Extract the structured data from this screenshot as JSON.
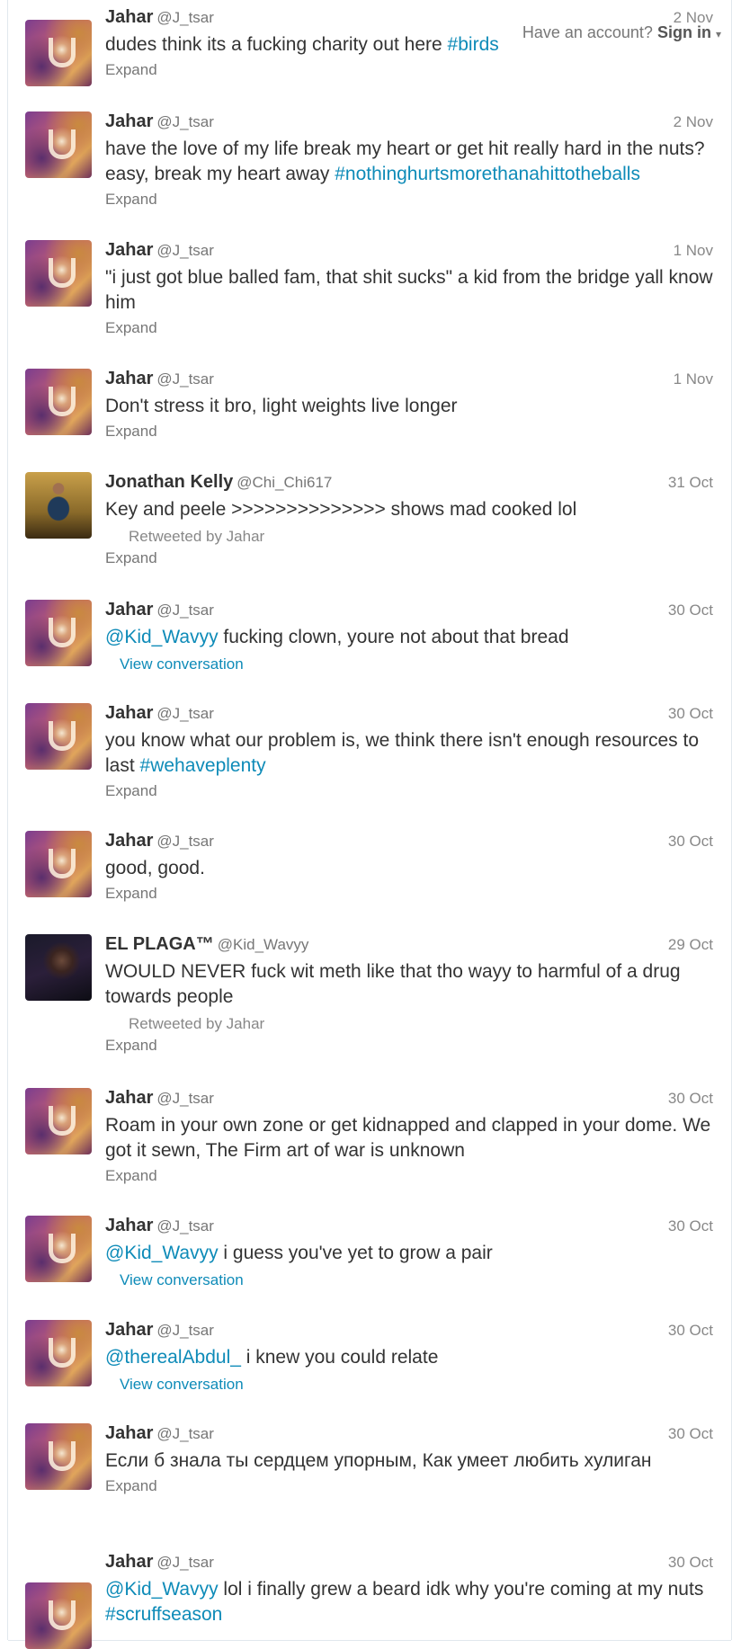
{
  "topbar": {
    "prompt": "Have an account?",
    "signin": "Sign in",
    "caret": "▾"
  },
  "tweets": [
    {
      "name": "Jahar",
      "handle": "@J_tsar",
      "time": "2 Nov",
      "avatar": "jahar",
      "parts": [
        {
          "t": "dudes think its a fucking charity out here "
        },
        {
          "t": "#birds",
          "link": true
        }
      ],
      "footer": "expand",
      "footer_text": "Expand"
    },
    {
      "name": "Jahar",
      "handle": "@J_tsar",
      "time": "2 Nov",
      "avatar": "jahar",
      "parts": [
        {
          "t": "have the love of my life break my heart or get hit really hard in the nuts? easy, break my heart away "
        },
        {
          "t": "#nothinghurtsmorethanahittotheballs",
          "link": true
        }
      ],
      "footer": "expand",
      "footer_text": "Expand"
    },
    {
      "name": "Jahar",
      "handle": "@J_tsar",
      "time": "1 Nov",
      "avatar": "jahar",
      "parts": [
        {
          "t": "\"i just got blue balled fam, that shit sucks\" a kid from the bridge yall know him"
        }
      ],
      "footer": "expand",
      "footer_text": "Expand"
    },
    {
      "name": "Jahar",
      "handle": "@J_tsar",
      "time": "1 Nov",
      "avatar": "jahar",
      "parts": [
        {
          "t": "Don't stress it bro, light weights live longer"
        }
      ],
      "footer": "expand",
      "footer_text": "Expand"
    },
    {
      "name": "Jonathan Kelly",
      "handle": "@Chi_Chi617",
      "time": "31 Oct",
      "avatar": "jonathan",
      "parts": [
        {
          "t": "Key and peele >>>>>>>>>>>>>> shows mad cooked lol"
        }
      ],
      "retweet": "Retweeted by Jahar",
      "footer": "expand",
      "footer_text": "Expand"
    },
    {
      "name": "Jahar",
      "handle": "@J_tsar",
      "time": "30 Oct",
      "avatar": "jahar",
      "parts": [
        {
          "t": "@Kid_Wavyy",
          "link": true
        },
        {
          "t": " fucking clown, youre not about that bread"
        }
      ],
      "footer": "conv",
      "footer_text": "View conversation"
    },
    {
      "name": "Jahar",
      "handle": "@J_tsar",
      "time": "30 Oct",
      "avatar": "jahar",
      "parts": [
        {
          "t": "you know what our problem is, we think there isn't enough resources to last "
        },
        {
          "t": "#wehaveplenty",
          "link": true
        }
      ],
      "footer": "expand",
      "footer_text": "Expand"
    },
    {
      "name": "Jahar",
      "handle": "@J_tsar",
      "time": "30 Oct",
      "avatar": "jahar",
      "parts": [
        {
          "t": "good, good."
        }
      ],
      "footer": "expand",
      "footer_text": "Expand"
    },
    {
      "name": "EL PLAGA™",
      "handle": "@Kid_Wavyy",
      "time": "29 Oct",
      "avatar": "plaga",
      "parts": [
        {
          "t": "WOULD NEVER fuck wit meth like that tho wayy to harmful of a drug towards people"
        }
      ],
      "retweet": "Retweeted by Jahar",
      "footer": "expand",
      "footer_text": "Expand"
    },
    {
      "name": "Jahar",
      "handle": "@J_tsar",
      "time": "30 Oct",
      "avatar": "jahar",
      "parts": [
        {
          "t": "Roam in your own zone or get kidnapped and clapped in your dome. We got it sewn, The Firm art of war is unknown"
        }
      ],
      "footer": "expand",
      "footer_text": "Expand"
    },
    {
      "name": "Jahar",
      "handle": "@J_tsar",
      "time": "30 Oct",
      "avatar": "jahar",
      "parts": [
        {
          "t": "@Kid_Wavyy",
          "link": true
        },
        {
          "t": " i guess you've yet to grow a pair"
        }
      ],
      "footer": "conv",
      "footer_text": "View conversation"
    },
    {
      "name": "Jahar",
      "handle": "@J_tsar",
      "time": "30 Oct",
      "avatar": "jahar",
      "parts": [
        {
          "t": "@therealAbdul_",
          "link": true
        },
        {
          "t": " i knew you could relate"
        }
      ],
      "footer": "conv",
      "footer_text": "View conversation"
    },
    {
      "name": "Jahar",
      "handle": "@J_tsar",
      "time": "30 Oct",
      "avatar": "jahar",
      "parts": [
        {
          "t": "Если б знала ты сердцем упорным, Как умеет любить хулиган"
        }
      ],
      "footer": "expand",
      "footer_text": "Expand"
    },
    {
      "name": "Jahar",
      "handle": "@J_tsar",
      "time": "30 Oct",
      "avatar": "jahar",
      "parts": [
        {
          "t": "@Kid_Wavyy",
          "link": true
        },
        {
          "t": " lol i finally grew a beard idk why you're coming at my nuts "
        },
        {
          "t": "#scruffseason",
          "link": true
        }
      ],
      "footer": "none"
    }
  ]
}
